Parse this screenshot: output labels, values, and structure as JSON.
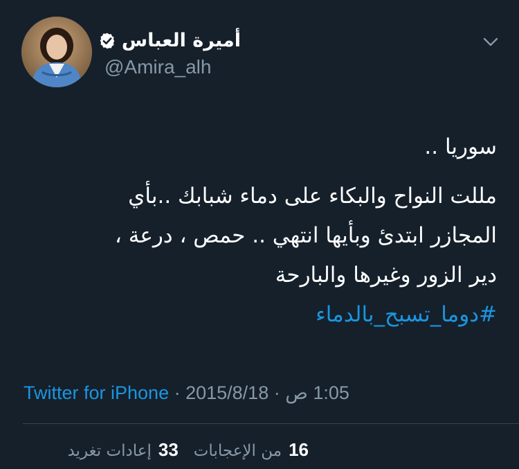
{
  "author": {
    "display_name": "أميرة العباس",
    "handle": "@Amira_alh",
    "verified": true,
    "avatar_icon": "profile-photo"
  },
  "tweet": {
    "line1": "سوريا ..",
    "line2": "مللت النواح والبكاء على دماء شبابك ..بأي",
    "line3": "المجازر ابتدئ وبأيها انتهي .. حمص ، درعة ،",
    "line4": "دير الزور وغيرها والبارحة",
    "hashtag": "#دوما_تسبح_بالدماء"
  },
  "meta": {
    "time": "1:05 ص",
    "separator": " · ",
    "date": "2015/8/18",
    "source": "Twitter for iPhone"
  },
  "stats": {
    "retweets_count": "33",
    "retweets_label": "إعادات تغريد",
    "likes_count": "16",
    "likes_label": "من الإعجابات"
  },
  "colors": {
    "background": "#15202b",
    "text": "#ffffff",
    "secondary": "#8899a6",
    "link": "#1b95e0",
    "divider": "#38444d"
  }
}
